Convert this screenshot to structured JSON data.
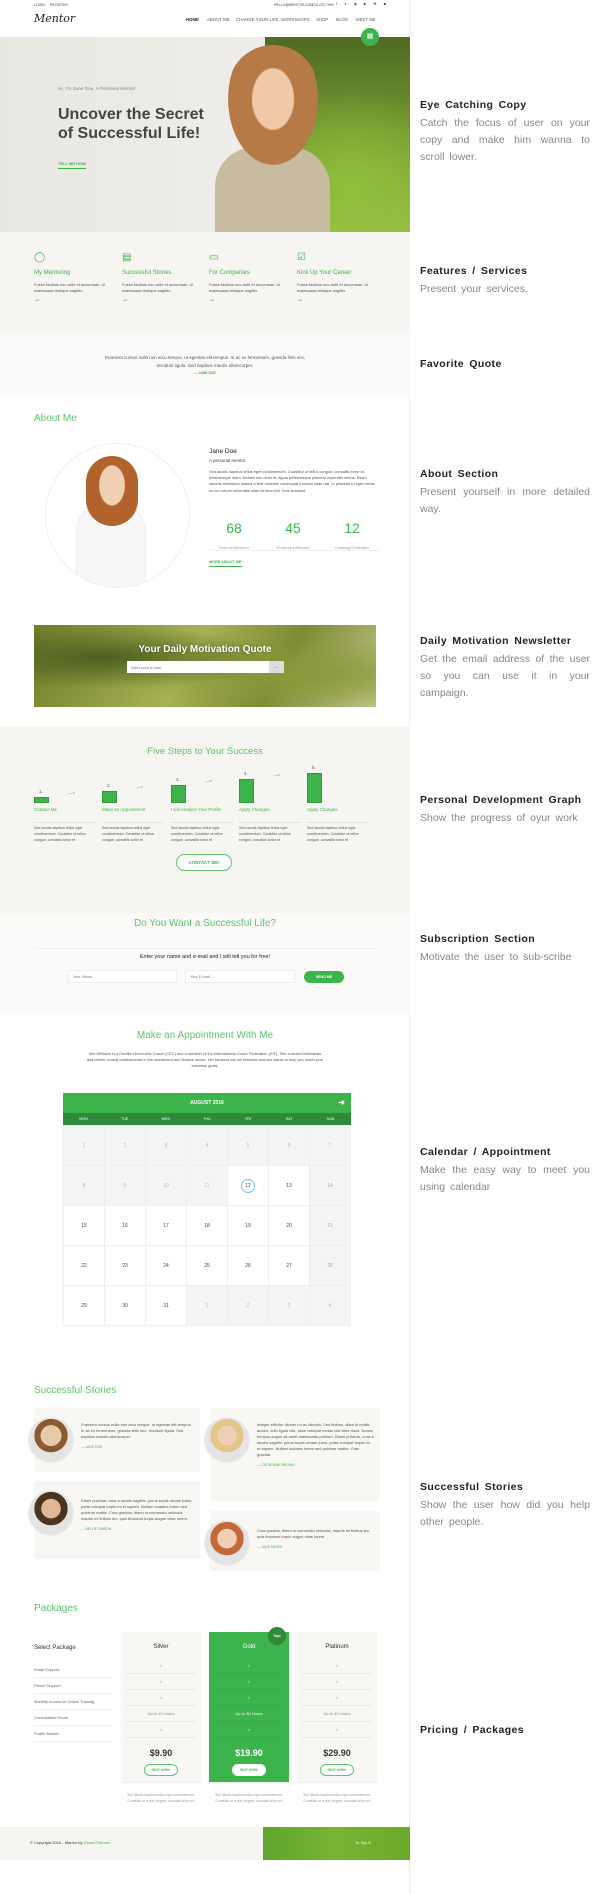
{
  "topbar": {
    "login": "LOGIN",
    "register": "REGISTER",
    "email": "HELLO@MENTOR.COM",
    "phone": "719-222-7990"
  },
  "header": {
    "logo": "Mentor",
    "nav": [
      "HOME",
      "ABOUT ME",
      "CHANGE YOUR LIFE",
      "WORKSHOPS",
      "SHOP",
      "BLOG",
      "MEET ME"
    ],
    "active": "HOME"
  },
  "hero": {
    "kicker": "Hi, I'm Jane Doe. A Personal Mentor",
    "headline1": "Uncover the Secret",
    "headline2": "of Successful Life!",
    "cta": "TELL ME HOW"
  },
  "features": [
    {
      "icon": "speech-bubble-icon",
      "title": "My Mentoring",
      "text": "Fusce facilisis nec ante et accumsan. Ut malesuada tristique sagittis"
    },
    {
      "icon": "id-badge-icon",
      "title": "Successful Stories",
      "text": "Fusce facilisis nec ante et accumsan. Ut malesuada tristique sagittis"
    },
    {
      "icon": "briefcase-icon",
      "title": "For Companies",
      "text": "Fusce facilisis nec ante et accumsan. Ut malesuada tristique sagittis"
    },
    {
      "icon": "checkbox-icon",
      "title": "Kick Up Your Career",
      "text": "Fusce facilisis nec ante et accumsan. Ut malesuada tristique sagittis"
    }
  ],
  "quote": {
    "text": "Praesent cursus nulla non arcu tempor, ut egestas elit tempus. In ac ex fermentum, gravida felis nec, tincidunt ligula. Sed dapibus mauris ullamcorper.",
    "author": "— JANE DOE"
  },
  "about": {
    "title": "About Me",
    "name": "Jane Doe",
    "role": "A personal mentor",
    "bio": "Sed iaculis dapibus tellus eget condimentum. Curabitur ut tellus congue, convallis tortor et, pellentesque diam. Nullam non dolor eu ligula pellentesque placerat imperdiet metus. Etiam lobortis bibendum massa a felis molestie consequat rhoncus vitae nisl. In pharetra In eget metus eu leo rutrum venenatis vitae sit amet elit. Duis tincidunt.",
    "stats": [
      {
        "value": "68",
        "label": "Persons Mentored"
      },
      {
        "value": "45",
        "label": "Workshops Attended"
      },
      {
        "value": "12",
        "label": "Coaching Certificates"
      }
    ],
    "more": "MORE ABOUT ME"
  },
  "newsletter": {
    "title": "Your Daily Motivation Quote",
    "placeholder": "Enter your e-mail",
    "submit": "→"
  },
  "steps": {
    "title": "Five Steps to Your Success",
    "items": [
      {
        "num": "1.",
        "label": "Contact Me",
        "level": 1,
        "text": "Sed iaculis dapibus tellus eget condimentum. Curabitur ut tellus congue, convallis tortor et"
      },
      {
        "num": "2.",
        "label": "Make an Appointment",
        "level": 2,
        "text": "Sed iaculis dapibus tellus eget condimentum. Curabitur ut tellus congue, convallis tortor et"
      },
      {
        "num": "3.",
        "label": "I will Analyze Your Profile",
        "level": 3,
        "text": "Sed iaculis dapibus tellus eget condimentum. Curabitur ut tellus congue, convallis tortor et"
      },
      {
        "num": "4.",
        "label": "Apply Changes",
        "level": 4,
        "text": "Sed iaculis dapibus tellus eget condimentum. Curabitur ut tellus congue, convallis tortor et"
      },
      {
        "num": "5.",
        "label": "Apply Changes",
        "level": 5,
        "text": "Sed iaculis dapibus tellus eget condimentum. Curabitur ut tellus congue, convallis tortor et"
      }
    ],
    "cta": "CONTACT ME!"
  },
  "subscribe": {
    "title": "Do You Want a Successful Life?",
    "lead": "Enter your name and e-mail and I will tell you for free!",
    "name_ph": "Your Name",
    "email_ph": "Your E-mail",
    "submit": "SEND ME"
  },
  "appointment": {
    "title": "Make an Appointment With Me",
    "text": "Kim Williams is a Certified Executive Coach (CEC) and a member of the International Coach Federation (ICF). She coaches individuals and teams, mostly professionals in the investment and finance sector. Her services are full featured and she wants to help you reach your business goals.",
    "calendar": {
      "month": "AUGUST 2016",
      "days": [
        "MON",
        "TUE",
        "WED",
        "THU",
        "FRI",
        "SAT",
        "SUN"
      ],
      "cells": [
        [
          "1",
          "past"
        ],
        [
          "2",
          "past"
        ],
        [
          "3",
          "past"
        ],
        [
          "4",
          "past"
        ],
        [
          "5",
          "past"
        ],
        [
          "6",
          "past"
        ],
        [
          "7",
          "past"
        ],
        [
          "8",
          "past"
        ],
        [
          "9",
          "past"
        ],
        [
          "10",
          "past"
        ],
        [
          "11",
          "past"
        ],
        [
          "12",
          "today"
        ],
        [
          "13",
          "normal"
        ],
        [
          "14",
          "weekend"
        ],
        [
          "15",
          "normal"
        ],
        [
          "16",
          "normal"
        ],
        [
          "17",
          "normal"
        ],
        [
          "18",
          "normal"
        ],
        [
          "19",
          "normal"
        ],
        [
          "20",
          "normal"
        ],
        [
          "21",
          "weekend"
        ],
        [
          "22",
          "normal"
        ],
        [
          "23",
          "normal"
        ],
        [
          "24",
          "normal"
        ],
        [
          "25",
          "normal"
        ],
        [
          "26",
          "normal"
        ],
        [
          "27",
          "normal"
        ],
        [
          "28",
          "weekend"
        ],
        [
          "29",
          "normal"
        ],
        [
          "30",
          "normal"
        ],
        [
          "31",
          "normal"
        ],
        [
          "1",
          "other"
        ],
        [
          "2",
          "other"
        ],
        [
          "3",
          "other"
        ],
        [
          "4",
          "other"
        ]
      ]
    }
  },
  "stories": {
    "title": "Successful Stories",
    "items": [
      {
        "text": "Praesent cursus nulla non arcu tempor, ut egestas elit tempus. In ac ex fermentum, gravida felis nec, tincidunt ligula. Sed dapibus mauris ullamcorper.",
        "author": "— JANE DOE"
      },
      {
        "text": "Etiam pulvinar, urna a iaculis sagittis, purus turpis ornare justo, porta volutpat turpis mi et sapien. Nullam sodales lorem sed pulvinar mattis. Cras gravida, libero in commodo vehicula, mauris mi finibus leo, quis tincidunt turpis augue vitae lorem.",
        "author": "— NELLIE GIBSON"
      },
      {
        "text": "Integer efficitur dictum mi ac lobortis. Sed finibus, diam id mollis auctor, odio ligula nisl, vitae volutpat metus nisl vitae risus. Donec tempus augue sit amet malesuada pretium. Etiam pulvinar, urna a iaculis sagittis, purus turpis ornare justo, porta volutpat turpis mi et sapien. Nullam sodales lorem sed pulvinar mattis. Cras gravida.",
        "author": "— CATHERINE BROWN"
      },
      {
        "text": "Cras gravida, libero in commodo vehicula, mauris mi finibus leo, quis tincidunt turpis augue vitae lorem.",
        "author": "— JACK HAYES"
      }
    ]
  },
  "packages": {
    "title": "Packages",
    "select": "Select Package",
    "features": [
      "Email Support",
      "Phone Support",
      "Monthly Access to Online Training",
      "Consultation Hours",
      "Profile Builder"
    ],
    "badge": "Top!",
    "plans": [
      {
        "name": "Silver",
        "values": [
          "✓",
          "✓",
          "×",
          "Up to 15 Hours",
          "×"
        ],
        "price": "$9.90",
        "buy": "BUY NOW",
        "desc": "Sed iaculis dapibus tellus eget condimentum. Curabitur ut tellus congue, convallis tortor et."
      },
      {
        "name": "Gold",
        "values": [
          "✓",
          "✓",
          "✓",
          "Up to 30 Hours",
          "×"
        ],
        "price": "$19.90",
        "buy": "BUY NOW",
        "desc": "Sed iaculis dapibus tellus eget condimentum. Curabitur ut tellus congue, convallis tortor et."
      },
      {
        "name": "Platinum",
        "values": [
          "✓",
          "✓",
          "✓",
          "Up to 45 Hours",
          "✓"
        ],
        "price": "$29.90",
        "buy": "BUY NOW",
        "desc": "Sed iaculis dapibus tellus eget condimentum. Curabitur ut tellus congue, convallis tortor et."
      }
    ]
  },
  "footer": {
    "copyright": "© Copyright 2016 - Mentor by ",
    "brand": "OceanThemes",
    "top": "To Top"
  },
  "annotations": [
    {
      "title": "Eye Catching Copy",
      "text": "Catch the focus of user on your copy and make him wanna to scroll lower."
    },
    {
      "title": "Features / Services",
      "text": "Present your services."
    },
    {
      "title": "Favorite Quote",
      "text": ""
    },
    {
      "title": "About Section",
      "text": "Present yourself in more detailed way."
    },
    {
      "title": "Daily Motivation Newsletter",
      "text": "Get the email address of the user so you can use it in your campaign."
    },
    {
      "title": "Personal Development Graph",
      "text": "Show the progress of oyur work"
    },
    {
      "title": "Subscription Section",
      "text": "Motivate the user to sub-scribe"
    },
    {
      "title": "Calendar / Appointment",
      "text": "Make the easy way to meet you using calendar"
    },
    {
      "title": "Successful Stories",
      "text": "Show the user how did you help other people."
    },
    {
      "title": "Pricing / Packages",
      "text": ""
    }
  ],
  "colors": {
    "accent": "#3cb44b",
    "heading": "#5ec46b",
    "panel": "#f6f5f1"
  }
}
